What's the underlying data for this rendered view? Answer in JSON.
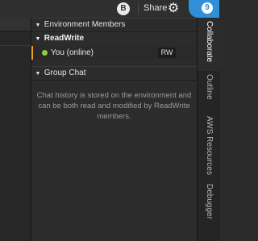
{
  "topbar": {
    "avatar_letter": "B",
    "share_label": "Share",
    "gear_icon": "gear-icon",
    "cloud_badge": "9",
    "accent": "#2f8fd8"
  },
  "panel": {
    "members_header": "Environment Members",
    "group_title": "ReadWrite",
    "member": {
      "name": "You (online)",
      "badge": "RW",
      "status_color": "#8fcf3c"
    },
    "chat_header": "Group Chat",
    "chat_info": "Chat history is stored on the environment and can be both read and modified by ReadWrite members."
  },
  "right_tabs": [
    {
      "label": "Collaborate",
      "active": true
    },
    {
      "label": "Outline",
      "active": false
    },
    {
      "label": "AWS Resources",
      "active": false
    },
    {
      "label": "Debugger",
      "active": false
    }
  ]
}
